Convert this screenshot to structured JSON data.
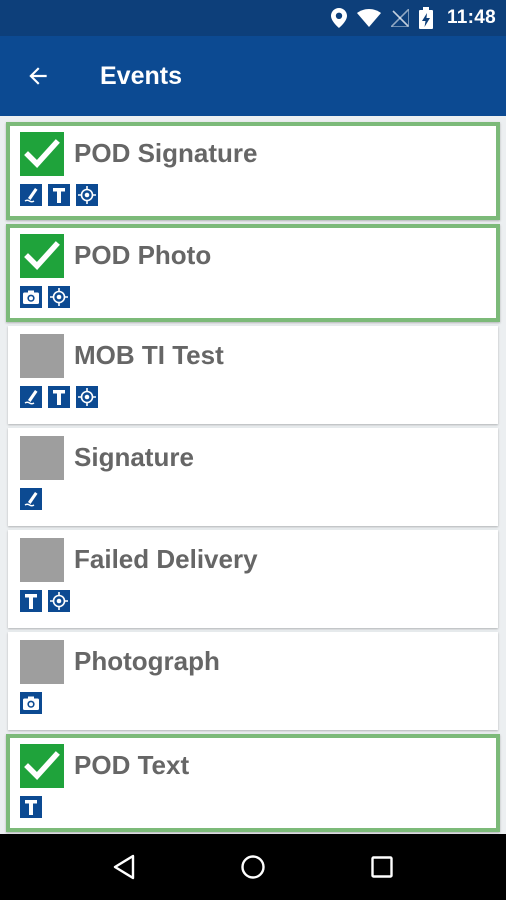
{
  "status_bar": {
    "time": "11:48",
    "icons": [
      "location-icon",
      "wifi-icon",
      "no-signal-icon",
      "battery-charging-icon"
    ]
  },
  "app_bar": {
    "back_icon": "arrow-back-icon",
    "title": "Events"
  },
  "colors": {
    "app_bar": "#0c4a92",
    "status_bar": "#0d3f7a",
    "completed_border": "#7cba79",
    "checkbox_on": "#1fa33b",
    "checkbox_off": "#9e9e9e",
    "icon_blue": "#0c4a92",
    "label_text": "#666666"
  },
  "events": [
    {
      "label": "POD Signature",
      "completed": true,
      "icons": [
        "signature-icon",
        "text-icon",
        "gps-icon"
      ]
    },
    {
      "label": "POD Photo",
      "completed": true,
      "icons": [
        "camera-icon",
        "gps-icon"
      ]
    },
    {
      "label": "MOB TI Test",
      "completed": false,
      "icons": [
        "signature-icon",
        "text-icon",
        "gps-icon"
      ]
    },
    {
      "label": "Signature",
      "completed": false,
      "icons": [
        "signature-icon"
      ]
    },
    {
      "label": "Failed Delivery",
      "completed": false,
      "icons": [
        "text-icon",
        "gps-icon"
      ]
    },
    {
      "label": "Photograph",
      "completed": false,
      "icons": [
        "camera-icon"
      ]
    },
    {
      "label": "POD Text",
      "completed": true,
      "icons": [
        "text-icon"
      ]
    }
  ],
  "nav_bar": {
    "icons": [
      "back-triangle-icon",
      "home-circle-icon",
      "recents-square-icon"
    ]
  }
}
